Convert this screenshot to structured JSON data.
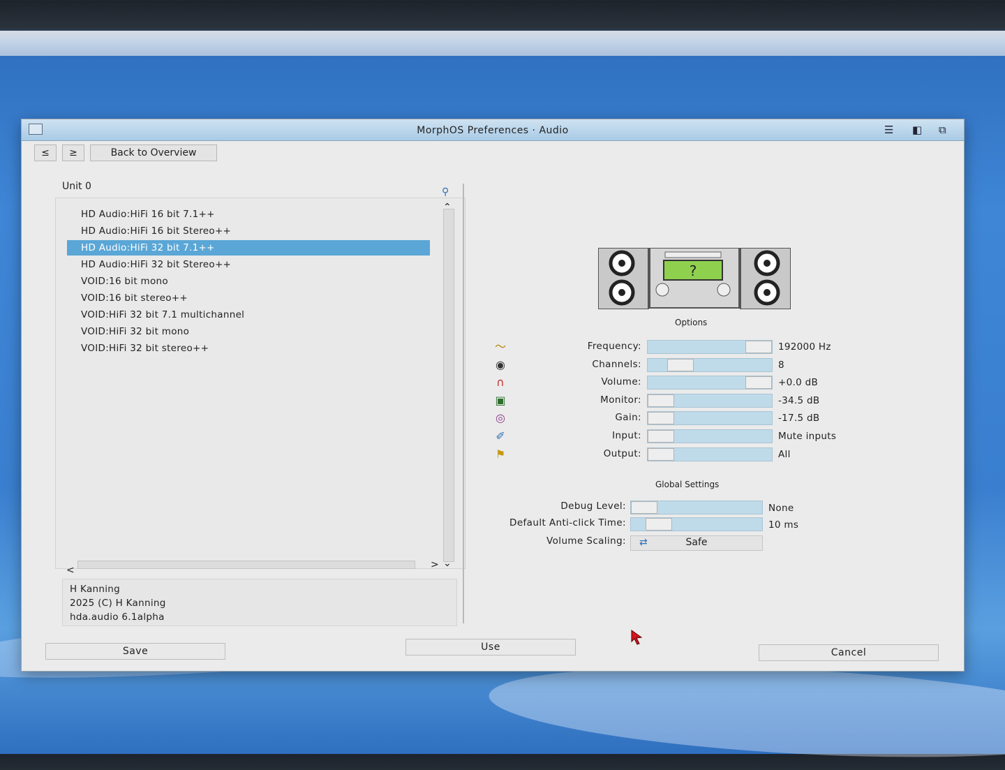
{
  "window": {
    "title": "MorphOS Preferences · Audio"
  },
  "nav": {
    "prev": "≤",
    "next": "≥",
    "back": "Back to Overview"
  },
  "unit": {
    "label": "Unit 0"
  },
  "modes": [
    "HD Audio:HiFi 16 bit 7.1++",
    "HD Audio:HiFi 16 bit Stereo++",
    "HD Audio:HiFi 32 bit 7.1++",
    "HD Audio:HiFi 32 bit Stereo++",
    "VOID:16 bit mono",
    "VOID:16 bit stereo++",
    "VOID:HiFi 32 bit 7.1 multichannel",
    "VOID:HiFi 32 bit mono",
    "VOID:HiFi 32 bit stereo++"
  ],
  "selected_mode_index": 2,
  "info": {
    "author": "H Kanning",
    "copyright": "2025 (C) H Kanning",
    "driver": "hda.audio 6.1alpha"
  },
  "options": {
    "heading": "Options",
    "rows": [
      {
        "label": "Frequency:",
        "value": "192000 Hz",
        "level": 1.0,
        "icon": "waveform-icon"
      },
      {
        "label": "Channels:",
        "value": "8",
        "level": 0.2,
        "icon": "speaker-icon"
      },
      {
        "label": "Volume:",
        "value": "+0.0 dB",
        "level": 1.0,
        "icon": "headphones-icon"
      },
      {
        "label": "Monitor:",
        "value": "-34.5 dB",
        "level": 0.0,
        "icon": "monitor-icon"
      },
      {
        "label": "Gain:",
        "value": "-17.5 dB",
        "level": 0.0,
        "icon": "disc-icon"
      },
      {
        "label": "Input:",
        "value": "Mute inputs",
        "level": 0.0,
        "icon": "microphone-icon"
      },
      {
        "label": "Output:",
        "value": "All",
        "level": 0.0,
        "icon": "horn-icon"
      }
    ]
  },
  "global": {
    "heading": "Global Settings",
    "debug": {
      "label": "Debug Level:",
      "value": "None",
      "level": 0.0
    },
    "anticlick": {
      "label": "Default Anti-click Time:",
      "value": "10 ms",
      "level": 0.05
    },
    "scaling": {
      "label": "Volume Scaling:",
      "value": "Safe"
    }
  },
  "buttons": {
    "save": "Save",
    "use": "Use",
    "cancel": "Cancel"
  }
}
